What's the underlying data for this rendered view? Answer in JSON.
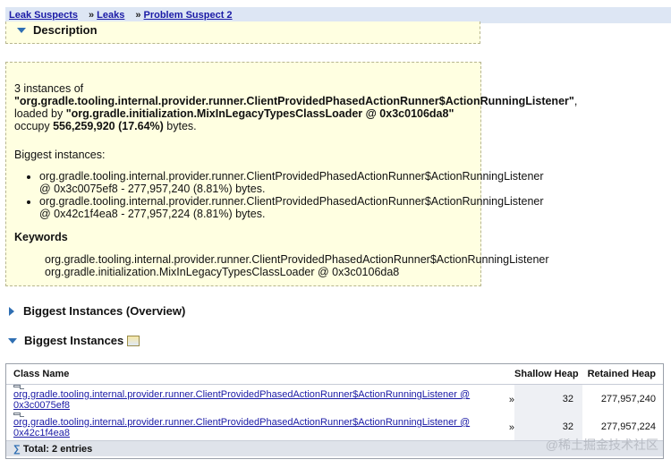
{
  "breadcrumb": {
    "items": [
      "Leak Suspects",
      "Leaks",
      "Problem Suspect 2"
    ],
    "separator": "»"
  },
  "sections": {
    "description": "Description",
    "overview": "Biggest Instances (Overview)",
    "biggest": "Biggest Instances"
  },
  "description": {
    "line1": "3 instances of",
    "classname": "\"org.gradle.tooling.internal.provider.runner.ClientProvidedPhasedActionRunner$ActionRunningListener\"",
    "comma": ",",
    "loaded_by": "loaded by",
    "loader": "\"org.gradle.initialization.MixInLegacyTypesClassLoader @ 0x3c0106da8\"",
    "occupy": "occupy",
    "size": "556,259,920 (17.64%)",
    "bytes": "bytes.",
    "biggest_title": "Biggest instances:",
    "bullets": [
      "org.gradle.tooling.internal.provider.runner.ClientProvidedPhasedActionRunner$ActionRunningListener @ 0x3c0075ef8 - 277,957,240 (8.81%) bytes.",
      "org.gradle.tooling.internal.provider.runner.ClientProvidedPhasedActionRunner$ActionRunningListener @ 0x42c1f4ea8 - 277,957,224 (8.81%) bytes."
    ],
    "keywords_title": "Keywords",
    "keywords": [
      "org.gradle.tooling.internal.provider.runner.ClientProvidedPhasedActionRunner$ActionRunningListener",
      "org.gradle.initialization.MixInLegacyTypesClassLoader @ 0x3c0106da8"
    ]
  },
  "table": {
    "headers": [
      "Class Name",
      "Shallow Heap",
      "Retained Heap"
    ],
    "rows": [
      {
        "name": "org.gradle.tooling.internal.provider.runner.ClientProvidedPhasedActionRunner$ActionRunningListener @ 0x3c0075ef8",
        "suffix": "»",
        "shallow": "32",
        "retained": "277,957,240"
      },
      {
        "name": "org.gradle.tooling.internal.provider.runner.ClientProvidedPhasedActionRunner$ActionRunningListener @ 0x42c1f4ea8",
        "suffix": "»",
        "shallow": "32",
        "retained": "277,957,224"
      }
    ],
    "total": "Total: 2 entries"
  },
  "watermark": "@稀土掘金技术社区",
  "icons": {
    "section-expanded": "triangle-down-icon",
    "section-collapsed": "triangle-right-icon",
    "row": "document-icon",
    "total": "sigma-icon",
    "biggest": "picture-icon"
  }
}
